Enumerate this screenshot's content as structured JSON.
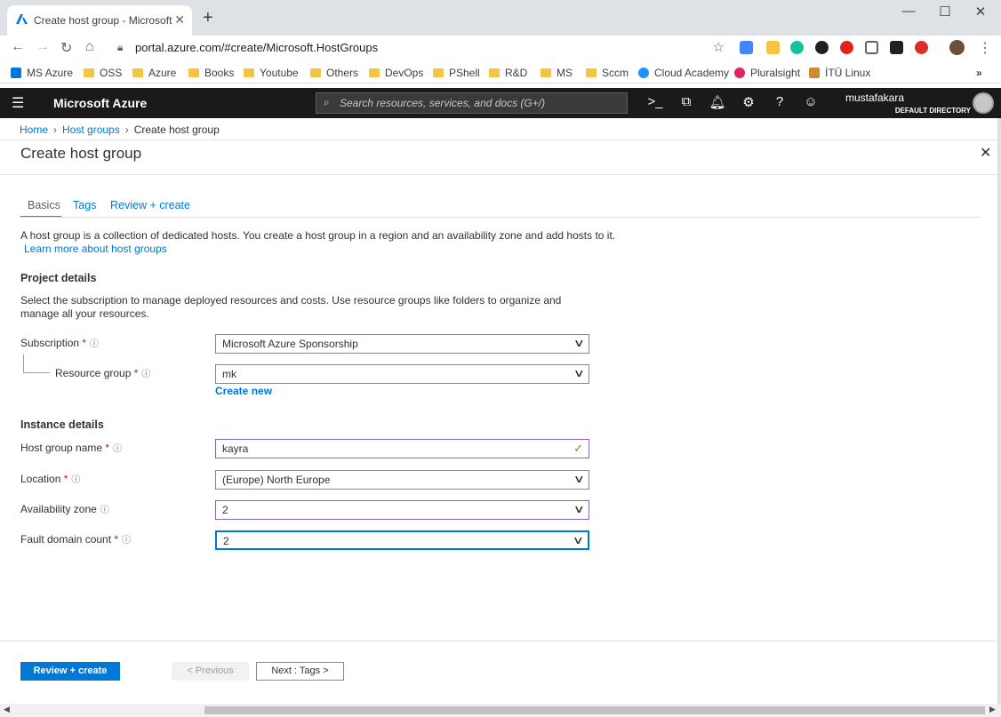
{
  "browser": {
    "tab_title": "Create host group - Microsoft Azure",
    "new_tab": "+",
    "url": "portal.azure.com/#create/Microsoft.HostGroups",
    "bookmarks": [
      "MS Azure",
      "OSS",
      "Azure",
      "Books",
      "Youtube",
      "Others",
      "DevOps",
      "PShell",
      "R&D",
      "MS",
      "Sccm",
      "Cloud Academy",
      "Pluralsight",
      "İTÜ Linux"
    ]
  },
  "azure": {
    "brand": "Microsoft Azure",
    "search_placeholder": "Search resources, services, and docs (G+/)",
    "user": "mustafakara",
    "directory": "DEFAULT DIRECTORY"
  },
  "breadcrumb": {
    "home": "Home",
    "host_groups": "Host groups",
    "current": "Create host group"
  },
  "blade": {
    "title": "Create host group",
    "tabs": [
      "Basics",
      "Tags",
      "Review + create"
    ],
    "intro": "A host group is a collection of dedicated hosts. You create a host group in a region and an availability zone and add hosts to it.",
    "learn_more": "Learn more about host groups",
    "project_details": {
      "heading": "Project details",
      "desc": "Select the subscription to manage deployed resources and costs. Use resource groups like folders to organize and manage all your resources.",
      "subscription_label": "Subscription",
      "subscription_value": "Microsoft Azure Sponsorship",
      "rg_label": "Resource group",
      "rg_value": "mk",
      "create_new": "Create new"
    },
    "instance_details": {
      "heading": "Instance details",
      "name_label": "Host group name",
      "name_value": "kayra",
      "location_label": "Location",
      "location_value": "(Europe) North Europe",
      "zone_label": "Availability zone",
      "zone_value": "2",
      "fault_label": "Fault domain count",
      "fault_value": "2"
    },
    "footer": {
      "review": "Review + create",
      "previous": "< Previous",
      "next": "Next : Tags >"
    }
  }
}
